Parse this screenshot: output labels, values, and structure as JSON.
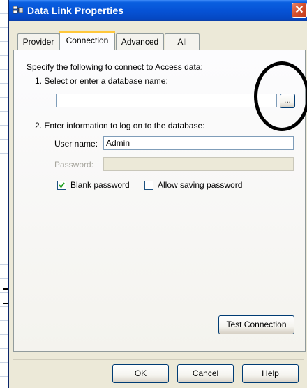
{
  "window": {
    "title": "Data Link Properties",
    "close_glyph": "✕"
  },
  "tabs": [
    {
      "label": "Provider",
      "active": false
    },
    {
      "label": "Connection",
      "active": true
    },
    {
      "label": "Advanced",
      "active": false
    },
    {
      "label": "All",
      "active": false
    }
  ],
  "connection": {
    "intro": "Specify the following to connect to Access data:",
    "step1_label": "1. Select or enter a database name:",
    "database_name_value": "",
    "browse_label": "...",
    "step2_label": "2. Enter information to log on to the database:",
    "user_name_label": "User name:",
    "user_name_value": "Admin",
    "password_label": "Password:",
    "password_value": "",
    "blank_password_label": "Blank password",
    "blank_password_checked": true,
    "allow_saving_label": "Allow saving password",
    "allow_saving_checked": false,
    "test_connection_label": "Test Connection"
  },
  "footer": {
    "ok_label": "OK",
    "cancel_label": "Cancel",
    "help_label": "Help"
  },
  "colors": {
    "titlebar": "#0653d6",
    "dialog_bg": "#ece9d8",
    "close_button": "#d4512e"
  }
}
